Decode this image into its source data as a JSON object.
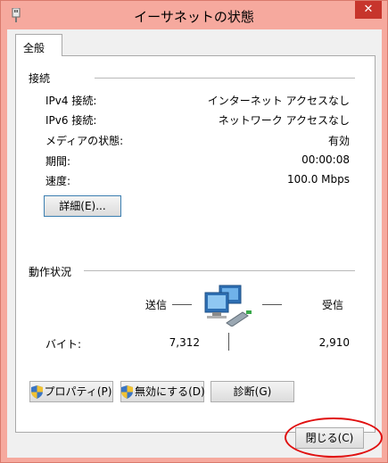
{
  "window": {
    "title": "イーサネットの状態",
    "close_glyph": "✕"
  },
  "tabs": [
    {
      "label": "全般"
    }
  ],
  "connection": {
    "section_label": "接続",
    "rows": [
      {
        "label": "IPv4 接続:",
        "value": "インターネット アクセスなし"
      },
      {
        "label": "IPv6 接続:",
        "value": "ネットワーク アクセスなし"
      },
      {
        "label": "メディアの状態:",
        "value": "有効"
      },
      {
        "label": "期間:",
        "value": "00:00:08"
      },
      {
        "label": "速度:",
        "value": "100.0 Mbps"
      }
    ],
    "details_button": "詳細(E)..."
  },
  "activity": {
    "section_label": "動作状況",
    "sent_label": "送信",
    "received_label": "受信",
    "bytes_label": "バイト:",
    "sent_bytes": "7,312",
    "received_bytes": "2,910",
    "icon": "network-computers-icon"
  },
  "buttons": {
    "properties": "プロパティ(P)",
    "disable": "無効にする(D)",
    "diagnose": "診断(G)",
    "close": "閉じる(C)"
  },
  "colors": {
    "frame": "#f6a99e",
    "close": "#c7352c",
    "highlight_ring": "#e01010"
  }
}
